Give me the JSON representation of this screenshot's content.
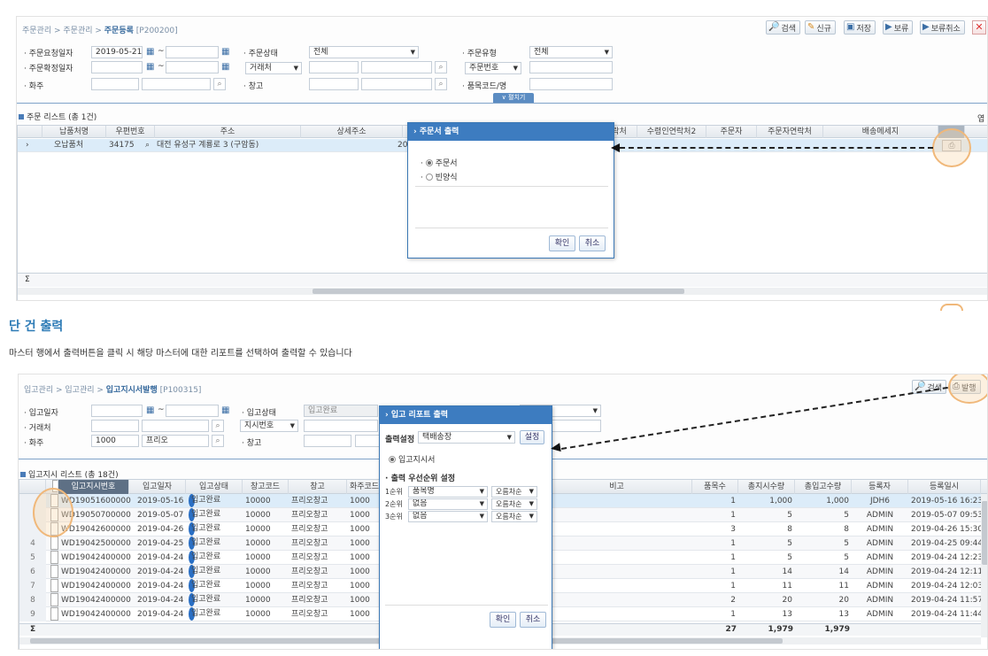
{
  "top": {
    "breadcrumb": {
      "a": "주문관리",
      "b": "주문관리",
      "c": "주문등록",
      "code": "[P200200]"
    },
    "toolbar": {
      "search": "검색",
      "new": "신규",
      "save": "저장",
      "hold": "보류",
      "hold_cancel": "보류취소"
    },
    "filters": {
      "order_request_date_label": "주문요청일자",
      "order_request_date_value": "2019-05-21",
      "order_confirm_date_label": "주문확정일자",
      "owner_label": "화주",
      "order_status_label": "주문상태",
      "order_status_value": "전체",
      "vendor_label": "거래처",
      "warehouse_label": "창고",
      "order_type_label": "주문유형",
      "order_type_value": "전체",
      "order_no_label": "주문번호",
      "item_code_label": "품목코드/명",
      "collapse_label": "펼치기"
    },
    "list_title": "주문 리스트 (총 1건)",
    "columns": [
      "납품처명",
      "우편번호",
      "주소",
      "상세주소",
      "락처",
      "수령인연락처2",
      "주문자",
      "주문자연락처",
      "배송메세지"
    ],
    "row": {
      "name": "오납품처",
      "zip": "34175",
      "addr": "대전 유성구 계룡로 3 (구암동)",
      "num": "20"
    },
    "footer_sigma": "Σ",
    "extra_right": "엽",
    "dialog": {
      "title": "주문서 출력",
      "options": [
        "주문서",
        "빈양식"
      ],
      "ok": "확인",
      "cancel": "취소"
    }
  },
  "heading": "단 건 출력",
  "description": "마스터 행에서 출력버튼을 클릭 시 해당 마스터에 대한 리포트를 선택하여 출력할 수 있습니다",
  "bottom": {
    "breadcrumb": {
      "a": "입고관리",
      "b": "입고관리",
      "c": "입고지시서발행",
      "code": "[P100315]"
    },
    "toolbar": {
      "search": "검색",
      "publish": "발행"
    },
    "filters": {
      "in_date_label": "입고일자",
      "vendor_label": "거래처",
      "owner_label": "화주",
      "owner_code": "1000",
      "owner_name": "프리오",
      "in_status_label": "입고상태",
      "in_status_value": "입고완료",
      "order_no_label": "지시번호",
      "warehouse_label": "창고"
    },
    "list_title": "입고지시 리스트 (총 18건)",
    "columns": [
      "입고지시번호",
      "입고일자",
      "입고상태",
      "창고코드",
      "창고",
      "화주코드",
      "비고",
      "품목수",
      "총지시수량",
      "총입고수량",
      "등록자",
      "등록일시"
    ],
    "rows": [
      {
        "n": "",
        "no": "WD1905160000003",
        "date": "2019-05-16",
        "status": "입고완료",
        "wh_code": "10000",
        "wh": "프리오창고",
        "owner": "1000",
        "items": "1",
        "qty": "1,000",
        "in_qty": "1,000",
        "user": "JDH6",
        "reg": "2019-05-16 16:23"
      },
      {
        "n": "",
        "no": "WD1905070000001",
        "date": "2019-05-07",
        "status": "입고완료",
        "wh_code": "10000",
        "wh": "프리오창고",
        "owner": "1000",
        "items": "1",
        "qty": "5",
        "in_qty": "5",
        "user": "ADMIN",
        "reg": "2019-05-07 09:53"
      },
      {
        "n": "",
        "no": "WD1904260000001",
        "date": "2019-04-26",
        "status": "입고완료",
        "wh_code": "10000",
        "wh": "프리오창고",
        "owner": "1000",
        "items": "3",
        "qty": "8",
        "in_qty": "8",
        "user": "ADMIN",
        "reg": "2019-04-26 15:30"
      },
      {
        "n": "4",
        "no": "WD1904250000001",
        "date": "2019-04-25",
        "status": "입고완료",
        "wh_code": "10000",
        "wh": "프리오창고",
        "owner": "1000",
        "items": "1",
        "qty": "5",
        "in_qty": "5",
        "user": "ADMIN",
        "reg": "2019-04-25 09:44"
      },
      {
        "n": "5",
        "no": "WD1904240000005",
        "date": "2019-04-24",
        "status": "입고완료",
        "wh_code": "10000",
        "wh": "프리오창고",
        "owner": "1000",
        "items": "1",
        "qty": "5",
        "in_qty": "5",
        "user": "ADMIN",
        "reg": "2019-04-24 12:23"
      },
      {
        "n": "6",
        "no": "WD1904240000004",
        "date": "2019-04-24",
        "status": "입고완료",
        "wh_code": "10000",
        "wh": "프리오창고",
        "owner": "1000",
        "items": "1",
        "qty": "14",
        "in_qty": "14",
        "user": "ADMIN",
        "reg": "2019-04-24 12:11"
      },
      {
        "n": "7",
        "no": "WD1904240000003",
        "date": "2019-04-24",
        "status": "입고완료",
        "wh_code": "10000",
        "wh": "프리오창고",
        "owner": "1000",
        "items": "1",
        "qty": "11",
        "in_qty": "11",
        "user": "ADMIN",
        "reg": "2019-04-24 12:03"
      },
      {
        "n": "8",
        "no": "WD1904240000002",
        "date": "2019-04-24",
        "status": "입고완료",
        "wh_code": "10000",
        "wh": "프리오창고",
        "owner": "1000",
        "items": "2",
        "qty": "20",
        "in_qty": "20",
        "user": "ADMIN",
        "reg": "2019-04-24 11:57"
      },
      {
        "n": "9",
        "no": "WD1904240000001",
        "date": "2019-04-24",
        "status": "입고완료",
        "wh_code": "10000",
        "wh": "프리오창고",
        "owner": "1000",
        "items": "1",
        "qty": "13",
        "in_qty": "13",
        "user": "ADMIN",
        "reg": "2019-04-24 11:44"
      }
    ],
    "totals": {
      "sigma": "Σ",
      "items": "27",
      "qty": "1,979",
      "in_qty": "1,979"
    },
    "dialog": {
      "title": "입고 리포트 출력",
      "setting_label": "출력설정",
      "setting_value": "택배송장",
      "setting_button": "설정",
      "option": "입고지시서",
      "priority_title": "출력 우선순위 설정",
      "priorities": [
        {
          "rank": "1순위",
          "field": "품목명",
          "order": "오름차순"
        },
        {
          "rank": "2순위",
          "field": "없음",
          "order": "오름차순"
        },
        {
          "rank": "3순위",
          "field": "없음",
          "order": "오름차순"
        }
      ],
      "ok": "확인",
      "cancel": "취소"
    }
  }
}
